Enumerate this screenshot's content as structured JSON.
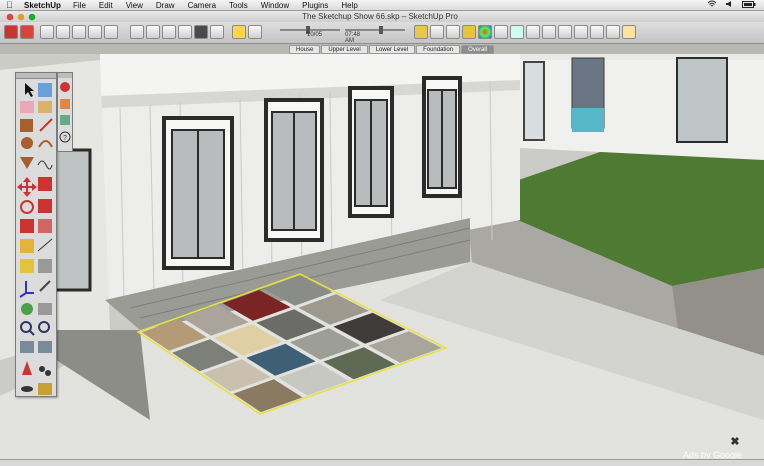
{
  "menubar": {
    "apple_icon": "apple-logo-icon",
    "app_name": "SketchUp",
    "items": [
      "File",
      "Edit",
      "View",
      "Draw",
      "Camera",
      "Tools",
      "Window",
      "Plugins",
      "Help"
    ],
    "status_icons": [
      "wifi-icon",
      "volume-icon",
      "battery-icon"
    ]
  },
  "window": {
    "title": "The Sketchup Show 66.skp – SketchUp Pro"
  },
  "shadows": {
    "date": "10/05",
    "time": "07:48 AM"
  },
  "scenes": {
    "tabs": [
      "House",
      "Upper Level",
      "Lower Level",
      "Foundation",
      "Overall"
    ],
    "active": "Overall"
  },
  "overlay": {
    "close_glyph": "✖",
    "ads_text": "Ads by Google"
  },
  "colors": {
    "sky": "#c8c8c6",
    "siding": "#ededeb",
    "grass": "#4e7a33",
    "stone": "#9b9b96",
    "selection": "#e8e23a"
  },
  "floor_swatches": [
    "#b59a78",
    "#aaa49a",
    "#7a2426",
    "#8a8c88",
    "#7d7f79",
    "#e0cfa3",
    "#6b6c68",
    "#9e998e",
    "#c9c1ad",
    "#3e5f76",
    "#9e9e98",
    "#403c3a",
    "#8a7a62",
    "#c8c8c3",
    "#5f6a55",
    "#a9a59c"
  ]
}
